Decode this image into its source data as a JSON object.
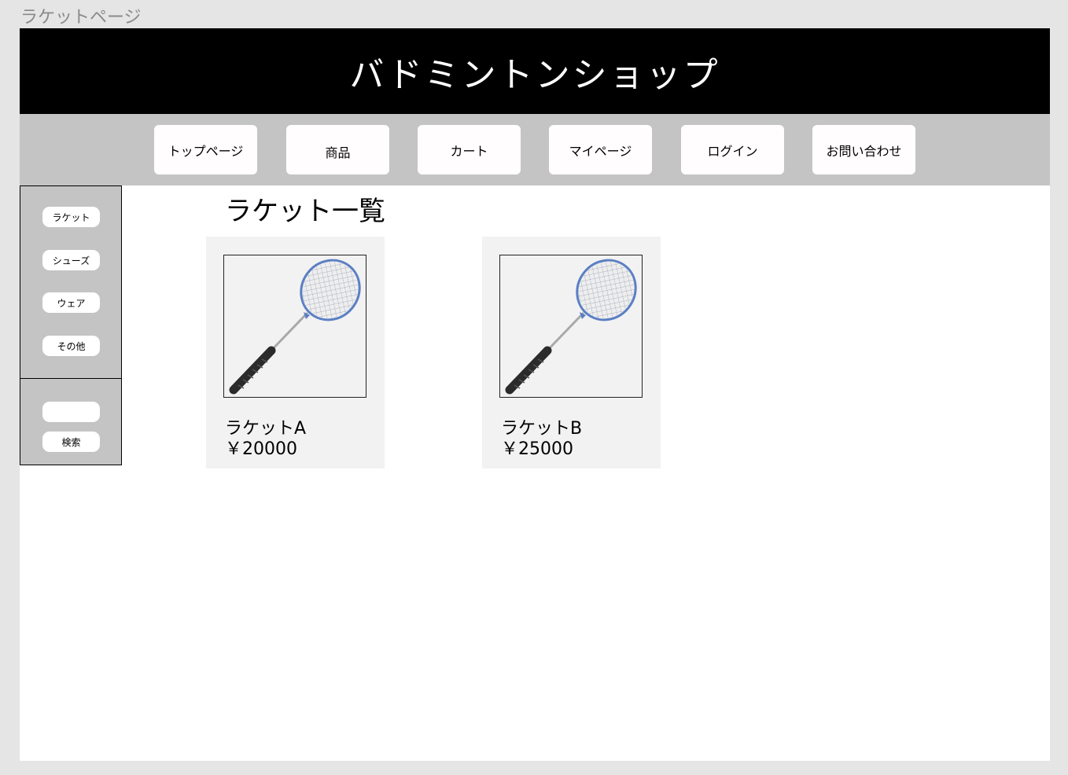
{
  "frame_label": "ラケットページ",
  "header": {
    "title": "バドミントンショップ"
  },
  "nav": {
    "items": [
      {
        "label": "トップページ"
      },
      {
        "label": "商品"
      },
      {
        "label": "カート"
      },
      {
        "label": "マイページ"
      },
      {
        "label": "ログイン"
      },
      {
        "label": "お問い合わせ"
      }
    ]
  },
  "sidebar": {
    "categories": [
      {
        "label": "ラケット"
      },
      {
        "label": "シューズ"
      },
      {
        "label": "ウェア"
      },
      {
        "label": "その他"
      }
    ],
    "search": {
      "input_value": "",
      "button_label": "検索"
    }
  },
  "main": {
    "heading": "ラケット一覧",
    "products": [
      {
        "name": "ラケットA",
        "price": "￥20000",
        "image_icon": "badminton-racket-icon"
      },
      {
        "name": "ラケットB",
        "price": "￥25000",
        "image_icon": "badminton-racket-icon"
      }
    ]
  },
  "colors": {
    "header_bg": "#000000",
    "nav_bg": "#c4c4c4",
    "card_bg": "#f2f2f2",
    "racket_frame": "#5b7fc4",
    "racket_grip": "#2b2b2b"
  }
}
